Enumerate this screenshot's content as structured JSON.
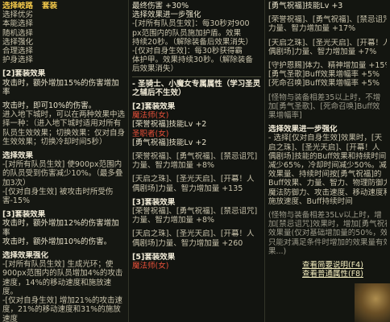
{
  "col1": {
    "title": "选择岐路",
    "title_suffix": "套装",
    "menu": [
      "选择优劣",
      "本能选择",
      "随机选择",
      "选择强化",
      "合理选择",
      "护身选择"
    ],
    "set2_title": "[2]套装效果",
    "set2_text": "攻击时，额外增加15%的伤害增加率",
    "set2_note": "攻击时，即可10%的伤害。",
    "set2_detail": "进入地下城时，可以在两种效果中选择一种：（进入地下城时适用对所有队员生效效果；切换效果：仅对自身生效效果；切换冷却时间5秒）",
    "choose_title": "选择效果",
    "choose_items": [
      "-[对所有队员生效] 使900px范围内的队员受到伤害减少10%。（最多叠加3次）",
      "-[仅对自身生效] 被攻击时所受伤害-15%"
    ],
    "set3_title": "[3]套装效果",
    "set3_text": "攻击时，额外增加12%的伤害增加率",
    "set3_note": "攻击时，额外增加10%的伤害。",
    "strengthen_title": "选择效果强化",
    "strengthen_items": [
      "-[对所有队员生效]  生成光环；使900px范围内的队员增加4%的攻击速度，14%的移动速度和施放速度。",
      "-[仅对自身生效]  增加21%的攻击速度，21%的移动速度和31%的施放速度"
    ]
  },
  "col2": {
    "top_lines": [
      "最终伤害 +30%",
      "选择效果进一步强化"
    ],
    "shield_lines": [
      "-[对所有队员生效]：每30秒对900",
      "px范围内的队员施加护盾。效果",
      "持续20秒。（解除装备后效果消失）",
      "-[仅对自身生效]：每30秒获得霸",
      "体护甲。效果持续30秒。（解除装备",
      "后效果消失）"
    ],
    "header": "- 圣骑士、小魔女专属属性（学习圣灵之辅后不生效）",
    "set2_title": "[2]套装效果",
    "job1": "魔法师(女)",
    "skill1": "[荣誉祝福]技能Lv +2",
    "job2": "圣职者(女)",
    "skill2": "[勇气祝福]技能Lv +2",
    "set2_lines": [
      "[荣誉祝福]、[勇气祝福]、[禁忌诅咒]",
      "力量、智力增加量 +8%"
    ],
    "sky_lines": [
      "[天启之珠]、[圣光天启]、[开幕！人",
      "偶剧场]力量、智力增加量 +135"
    ],
    "set3_title": "[3]套装效果",
    "set3_lines": [
      "[荣誉祝福]、[勇气祝福]、[禁忌诅咒]",
      "力量、智力增加量 +8%"
    ],
    "sky3_lines": [
      "[天启之珠]、[圣光天启]、[开幕！人",
      "偶剧场]力量、智力增加量 +260"
    ],
    "set5_title": "[5]套装效果",
    "job3": "魔法师(女)"
  },
  "col3": {
    "top": "[勇气祝福]技能Lv +3",
    "block1": [
      "[荣誉祝福]、[勇气祝福]、[禁忌诅咒]",
      "力量、智力增加量 +17%"
    ],
    "block2": [
      "[天启之珠]、[圣光天启]、[开幕！人",
      "偶剧场]力量、智力增加量 +7%"
    ],
    "block3": [
      "[守护恩赐]体力、精神增加量 +15%",
      "[勇气圣歌]Buff效果增幅率 +5%",
      "[死命召唤]Buff效果增幅率 +5%"
    ],
    "block4": [
      "[怪物与装备相差35以上时，不增",
      "加[勇气圣歌]、[死命召唤]Buff效",
      "果增幅率]"
    ],
    "block5_title": "选择效果进一步强化",
    "block5": [
      "- 选择[仅对自身生效]效果时，[天",
      "启之珠]、[圣光天启]、[开幕！人",
      "偶剧场]技能的Buff效果和持续时间",
      "减少65%，冷却时间减少50%。减少后",
      "效果量、持续时间按[勇气祝福]的",
      "Buff效果、力量、智力、物理防御力",
      "魔法防御力、攻击速度、移动速度和",
      "施放速度、Buff持续时间"
    ],
    "block6": [
      "(怪物与装备相差35Lv以上时，增",
      "加[禁忌诅咒]效果时，增加[勇气祝福]",
      "效果量(仅对基础增加量的50%，效果",
      "只能对满足条件时增加的效果量有效",
      "果...)"
    ],
    "link1": "查看简要说明(F4)",
    "link2": "查看普通属性(F8)"
  }
}
